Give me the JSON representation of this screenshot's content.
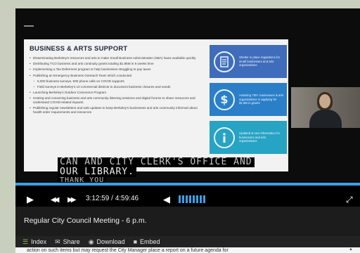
{
  "slide": {
    "title": "BUSINESS & ARTS SUPPORT",
    "bullets": [
      {
        "text": "Disseminating Berkeley's resources and arts to make Small Business Administration (SBA) loans available quickly",
        "sub": false
      },
      {
        "text": "Distributing TCO business and arts continuity grants totaling $1.85M in 6 weeks time",
        "sub": false
      },
      {
        "text": "Implementing a Tax Deferment program to help businesses struggling to pay taxes",
        "sub": false
      },
      {
        "text": "Publishing an Emergency Business Outreach Team which conducted",
        "sub": false
      },
      {
        "text": "5,000 business surveys, 500 phone calls on COVID supports",
        "sub": true
      },
      {
        "text": "Field surveys in Berkeley's 10 commercial districts to document business closures and needs",
        "sub": true
      },
      {
        "text": "Launching Berkeley's Outdoor Commerce Program",
        "sub": false
      },
      {
        "text": "Hosting and convening business and arts community listening sessions and digital forums to share resources and understand COVID-related impacts",
        "sub": false
      },
      {
        "text": "Publishing regular newsletters and web updates to keep Berkeley's businesses and arts community informed about health order requirements and resources",
        "sub": false
      }
    ],
    "features": [
      {
        "icon": "document-icon",
        "text": "Shelter in place regulations for small businesses and arts organizations"
      },
      {
        "icon": "dollar-icon",
        "text": "Assisting 700+ businesses & arts organizations in applying for $1.8M in grants"
      },
      {
        "icon": "info-icon",
        "text": "Updated & new information for businesses and arts organizations"
      }
    ]
  },
  "captions": {
    "line1": "CAN AND CITY CLERK'S OFFICE AND",
    "line2": "OUR LIBRARY.",
    "line3": "THANK YOU"
  },
  "player": {
    "time": "3:12:59 / 4:59:46",
    "play_icon": "▶",
    "rewind_icon": "◀◀",
    "forward_icon": "▶▶",
    "volume_icon": "◀",
    "fullscreen_icon": "⤢",
    "accent": "#3aa0e6"
  },
  "meeting_title": "Regular City Council Meeting - 6 p.m.",
  "tabs": [
    {
      "label": "Index",
      "icon": "list-icon",
      "glyph": "☰"
    },
    {
      "label": "Share",
      "icon": "mail-icon",
      "glyph": "✉"
    },
    {
      "label": "Download",
      "icon": "download-icon",
      "glyph": "◉"
    },
    {
      "label": "Embed",
      "icon": "embed-icon",
      "glyph": "■"
    }
  ],
  "index_text": "action on such items but may request the City Manager place a report on a future agenda for",
  "scroll_arrow": "▲"
}
